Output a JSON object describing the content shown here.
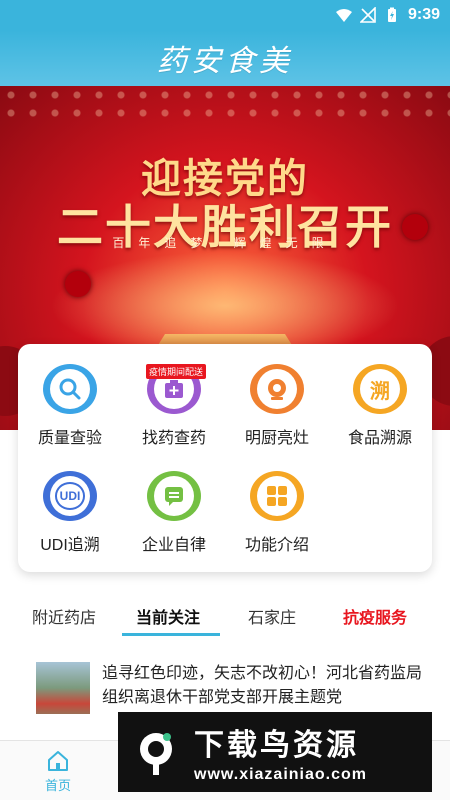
{
  "status_bar": {
    "time": "9:39"
  },
  "header": {
    "logo_text": "药安食美"
  },
  "banner": {
    "title_line1": "迎接党的",
    "title_line2": "二十大胜利召开",
    "subtitle": "百年追梦 辉煌无限"
  },
  "grid": {
    "items": [
      {
        "label": "质量查验",
        "icon": "search-icon",
        "color": "#3aa4e6"
      },
      {
        "label": "找药查药",
        "icon": "medicine-box-icon",
        "color": "#9b59d0",
        "tag": "疫情期间配送"
      },
      {
        "label": "明厨亮灶",
        "icon": "camera-icon",
        "color": "#f08030"
      },
      {
        "label": "食品溯源",
        "icon": "trace-icon",
        "color": "#f5a623",
        "glyph": "溯"
      },
      {
        "label": "UDI追溯",
        "icon": "udi-icon",
        "color": "#3f6fd8",
        "glyph": "UDI"
      },
      {
        "label": "企业自律",
        "icon": "message-icon",
        "color": "#74c043"
      },
      {
        "label": "功能介绍",
        "icon": "grid-icon",
        "color": "#f5a623"
      }
    ]
  },
  "tabs": [
    {
      "label": "附近药店"
    },
    {
      "label": "当前关注"
    },
    {
      "label": "石家庄"
    },
    {
      "label": "抗疫服务"
    }
  ],
  "news": {
    "text": "追寻红色印迹，矢志不改初心！河北省药监局组织离退休干部党支部开展主题党"
  },
  "bottom_nav": {
    "home_label": "首页"
  },
  "watermark": {
    "title": "下载鸟资源",
    "url": "www.xiazainiao.com"
  }
}
